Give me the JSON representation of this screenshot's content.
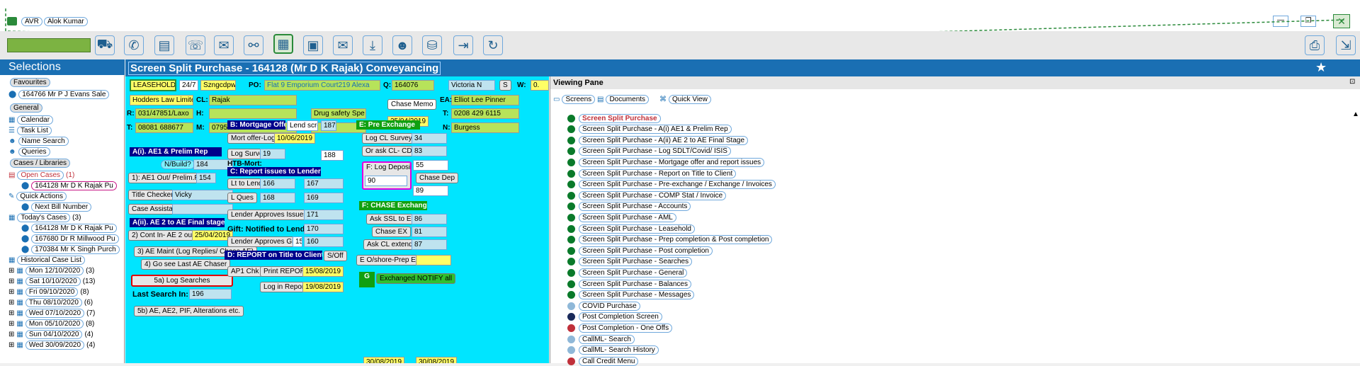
{
  "titlebar": {
    "app_code": "AVR",
    "user": "Alok Kumar"
  },
  "toolbar": {
    "search_value": ""
  },
  "sidebar": {
    "title": "Selections",
    "favourites_header": "Favourites",
    "favourite_item": "164766 Mr P J Evans Sale",
    "general_header": "General",
    "general_items": [
      "Calendar",
      "Task List",
      "Name Search",
      "Queries"
    ],
    "cases_header": "Cases / Libraries",
    "open_cases": "Open Cases",
    "open_cases_count": "(1)",
    "open_case_item": "164128 Mr D K Rajak Pu",
    "quick_actions": "Quick Actions",
    "next_bill": "Next Bill Number",
    "todays_cases": "Today's Cases",
    "todays_count": "(3)",
    "today_items": [
      "164128 Mr D K Rajak Pu",
      "167680 Dr R Millwood Pu",
      "170384 Mr K Singh Purch"
    ],
    "historical": "Historical Case List",
    "history": [
      {
        "day": "Mon 12/10/2020",
        "count": "(3)"
      },
      {
        "day": "Sat 10/10/2020",
        "count": "(13)"
      },
      {
        "day": "Fri 09/10/2020",
        "count": "(8)"
      },
      {
        "day": "Thu 08/10/2020",
        "count": "(6)"
      },
      {
        "day": "Wed 07/10/2020",
        "count": "(7)"
      },
      {
        "day": "Mon 05/10/2020",
        "count": "(8)"
      },
      {
        "day": "Sun 04/10/2020",
        "count": "(4)"
      },
      {
        "day": "Wed 30/09/2020",
        "count": "(4)"
      }
    ]
  },
  "main": {
    "title": "Screen Split Purchase - 164128 (Mr D K Rajak) Conveyancing",
    "tenure": "LEASEHOLD",
    "hours": "24/7",
    "code": "Szngcdpw",
    "po_label": "PO:",
    "property": "Flat 9 Emporium Court219 Alexa",
    "q_label": "Q:",
    "q_value": "164076",
    "victoria": "Victoria N",
    "s_btn": "S",
    "w_label": "W:",
    "w_value": "0.",
    "firm": "Hodders Law Limited",
    "cl_label": "CL:",
    "client": "Rajak",
    "r_label": "R:",
    "ref": "031/47851/Laxo",
    "h_label": "H:",
    "t_label": "T:",
    "phone1": "08081 688677",
    "m_label": "M:",
    "mobile": "07958 248566",
    "drug_safety": "Drug safety Spe",
    "chase_memo": "Chase Memo",
    "memo_date": "25/04/2019",
    "ea_label": "EA:",
    "agent": "Elliot Lee Pinner",
    "t2_label": "T:",
    "phone2": "0208 429 6115",
    "n_label": "N:",
    "n_value": "Burgess",
    "sec_a1": "A(i). AE1 & Prelim Rep",
    "n_build": "N/Build?",
    "n_build_val": "184",
    "ae1_out": "1): AE1 Out/ Prelim.Rpt",
    "ae1_num": "154",
    "title_checker": "Title Checker",
    "checker_name": "Vicky",
    "case_assistant": "Case Assistant",
    "sec_a2": "A(ii). AE 2 to AE Final stage",
    "cont_in": "2) Cont In- AE 2 out",
    "cont_date": "25/04/2019",
    "ae_maint": "3) AE Maint (Log Replies/ Chase AE)",
    "go_see": "4) Go see Last AE Chaser",
    "log_searches": "5a) Log Searches",
    "last_search": "Last Search In:",
    "last_search_val": "196",
    "alterations": "5b) AE, AE2, PIF, Alterations etc.",
    "sec_b": "B: Mortgage Offer",
    "lend_scr": "Lend scre",
    "lend_num": "187",
    "mort_offer_log": "Mort offer-Log",
    "mort_date": "10/06/2019",
    "log_survey": "Log Survey",
    "survey_val": "19",
    "htb_val": "188",
    "htb_mort": "HTB-Mort:",
    "sec_c": "C: Report issues to Lender",
    "lt_to_lend": "Lt to Lend",
    "lt_a": "166",
    "lt_b": "167",
    "l_ques": "L Ques",
    "lq_a": "168",
    "lq_b": "169",
    "lender_approves": "Lender Approves Issues",
    "la_num": "171",
    "gift": "Gift: Notified to Lend",
    "gift_num": "170",
    "lender_gift": "Lender Approves Gift",
    "lg_a": "15",
    "lg_b": "160",
    "sec_d": "D: REPORT on Title to Client",
    "s_off": "S/Off",
    "ap1_chk": "AP1 Chk",
    "print_report": "Print REPORT",
    "print_date": "15/08/2019",
    "log_in_report": "Log in Report",
    "report_date": "19/08/2019",
    "sec_e": "E: Pre Exchange",
    "log_cl_survey": "Log CL Survey",
    "cl_survey_val": "34",
    "or_ask": "Or ask CL- CD",
    "or_ask_val": "83",
    "log_deposit": "F: Log Deposit",
    "deposit_a": "55",
    "deposit_val": "90",
    "chase_dep": "Chase Dep",
    "dep_num": "89",
    "sec_f": "F: CHASE Exchange",
    "ask_ssl": "Ask SSL to EX",
    "ask_ssl_val": "86",
    "chase_ex": "Chase EX",
    "chase_ex_val": "81",
    "ask_cl": "Ask CL extend Ex",
    "ask_cl_val": "87",
    "eo_shore": "E O/shore-Prep Ex",
    "g_label": "G",
    "exchanged": "Exchanged NOTIFY all",
    "bottom_date1": "30/08/2019",
    "bottom_date2": "30/08/2019"
  },
  "viewing_pane": {
    "title": "Viewing Pane",
    "tabs": [
      "Screens",
      "Documents",
      "Quick View"
    ],
    "items": [
      {
        "label": "Screen Split Purchase",
        "color": "#0a7a2a",
        "highlight": true
      },
      {
        "label": "Screen Split Purchase - A(i) AE1 & Prelim Rep",
        "color": "#0a7a2a"
      },
      {
        "label": "Screen Split Purchase - A(ii) AE 2 to AE Final Stage",
        "color": "#0a7a2a"
      },
      {
        "label": "Screen Split Purchase - Log SDLT/Covid/ ISIS",
        "color": "#0a7a2a"
      },
      {
        "label": "Screen Split Purchase - Mortgage offer and report issues",
        "color": "#0a7a2a"
      },
      {
        "label": "Screen Split Purchase - Report on Title to Client",
        "color": "#0a7a2a"
      },
      {
        "label": "Screen Split Purchase - Pre-exchange / Exchange / Invoices",
        "color": "#0a7a2a"
      },
      {
        "label": "Screen Split Purchase - COMP Stat / Invoice",
        "color": "#0a7a2a"
      },
      {
        "label": "Screen Split Purchase - Accounts",
        "color": "#0a7a2a"
      },
      {
        "label": "Screen Split Purchase - AML",
        "color": "#0a7a2a"
      },
      {
        "label": "Screen Split Purchase - Leasehold",
        "color": "#0a7a2a"
      },
      {
        "label": "Screen Split Purchase - Prep completion & Post completion",
        "color": "#0a7a2a"
      },
      {
        "label": "Screen Split Purchase - Post completion",
        "color": "#0a7a2a"
      },
      {
        "label": "Screen Split Purchase - Searches",
        "color": "#0a7a2a"
      },
      {
        "label": "Screen Split Purchase - General",
        "color": "#0a7a2a"
      },
      {
        "label": "Screen Split Purchase - Balances",
        "color": "#0a7a2a"
      },
      {
        "label": "Screen Split Purchase - Messages",
        "color": "#0a7a2a"
      },
      {
        "label": "COVID Purchase",
        "color": "#8fb8d8"
      },
      {
        "label": "Post Completion Screen",
        "color": "#1a2a5a"
      },
      {
        "label": "Post Completion - One Offs",
        "color": "#c0303a"
      },
      {
        "label": "CallML- Search",
        "color": "#8fb8d8"
      },
      {
        "label": "CallML- Search History",
        "color": "#8fb8d8"
      },
      {
        "label": "Call Credit Menu",
        "color": "#c0303a"
      }
    ]
  }
}
